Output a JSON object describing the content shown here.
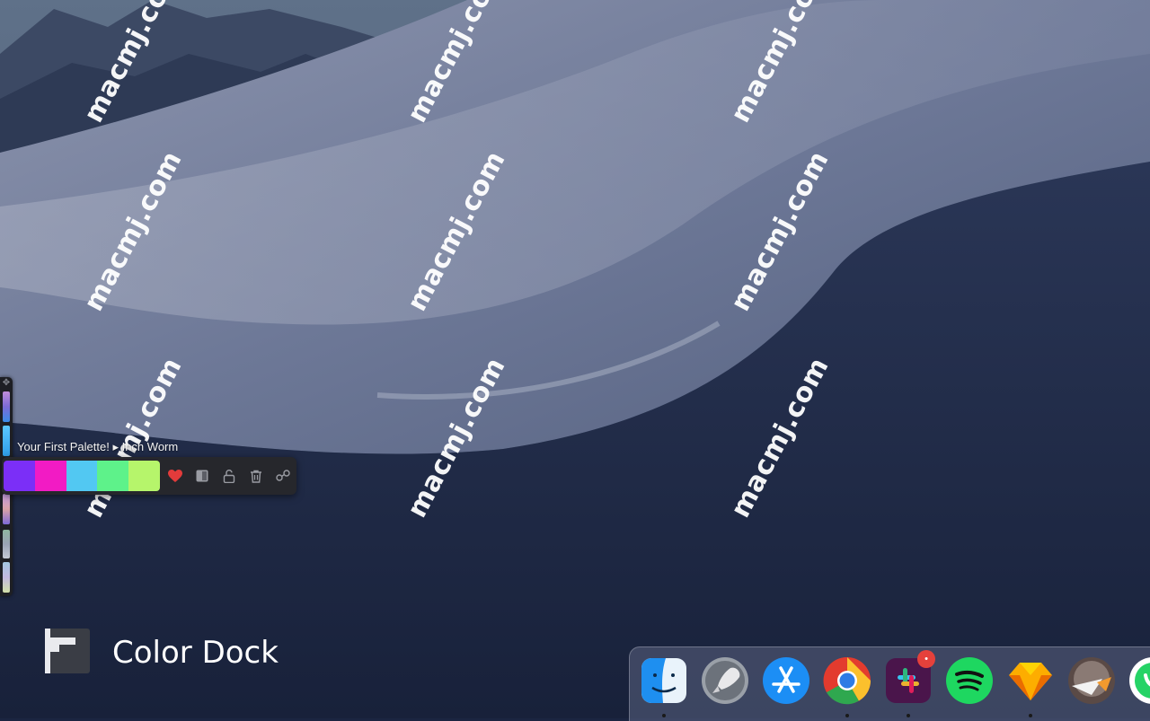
{
  "watermark_text": "macmj.com",
  "palette": {
    "label": "Your First Palette! ▸ Inch Worm",
    "colors": [
      "#7b2ff7",
      "#f21bc4",
      "#52c8f2",
      "#5ef28a",
      "#b6f56b"
    ],
    "strip_colors": [
      "#c08dd9",
      "#3a8de8",
      "#5cc8ff",
      "#c8a0e8",
      "#d9a2a6",
      "#8fb7a0",
      "#9aa3b5",
      "#a3c7e0"
    ]
  },
  "tools": [
    "heart-icon",
    "contrast-icon",
    "lock-icon",
    "trash-icon",
    "share-icon"
  ],
  "brand": {
    "title": "Color Dock"
  },
  "dock": {
    "apps": [
      {
        "name": "finder-icon",
        "running": true
      },
      {
        "name": "launchpad-icon",
        "running": false
      },
      {
        "name": "app-store-icon",
        "running": false
      },
      {
        "name": "chrome-icon",
        "running": true
      },
      {
        "name": "slack-icon",
        "running": true,
        "badge": "•"
      },
      {
        "name": "spotify-icon",
        "running": false
      },
      {
        "name": "sketch-icon",
        "running": true
      },
      {
        "name": "mail-icon",
        "running": false
      },
      {
        "name": "whatsapp-icon",
        "running": false
      }
    ]
  },
  "colors": {
    "accent_heart": "#e33b3b",
    "dock_bg": "#7f8aa8"
  }
}
